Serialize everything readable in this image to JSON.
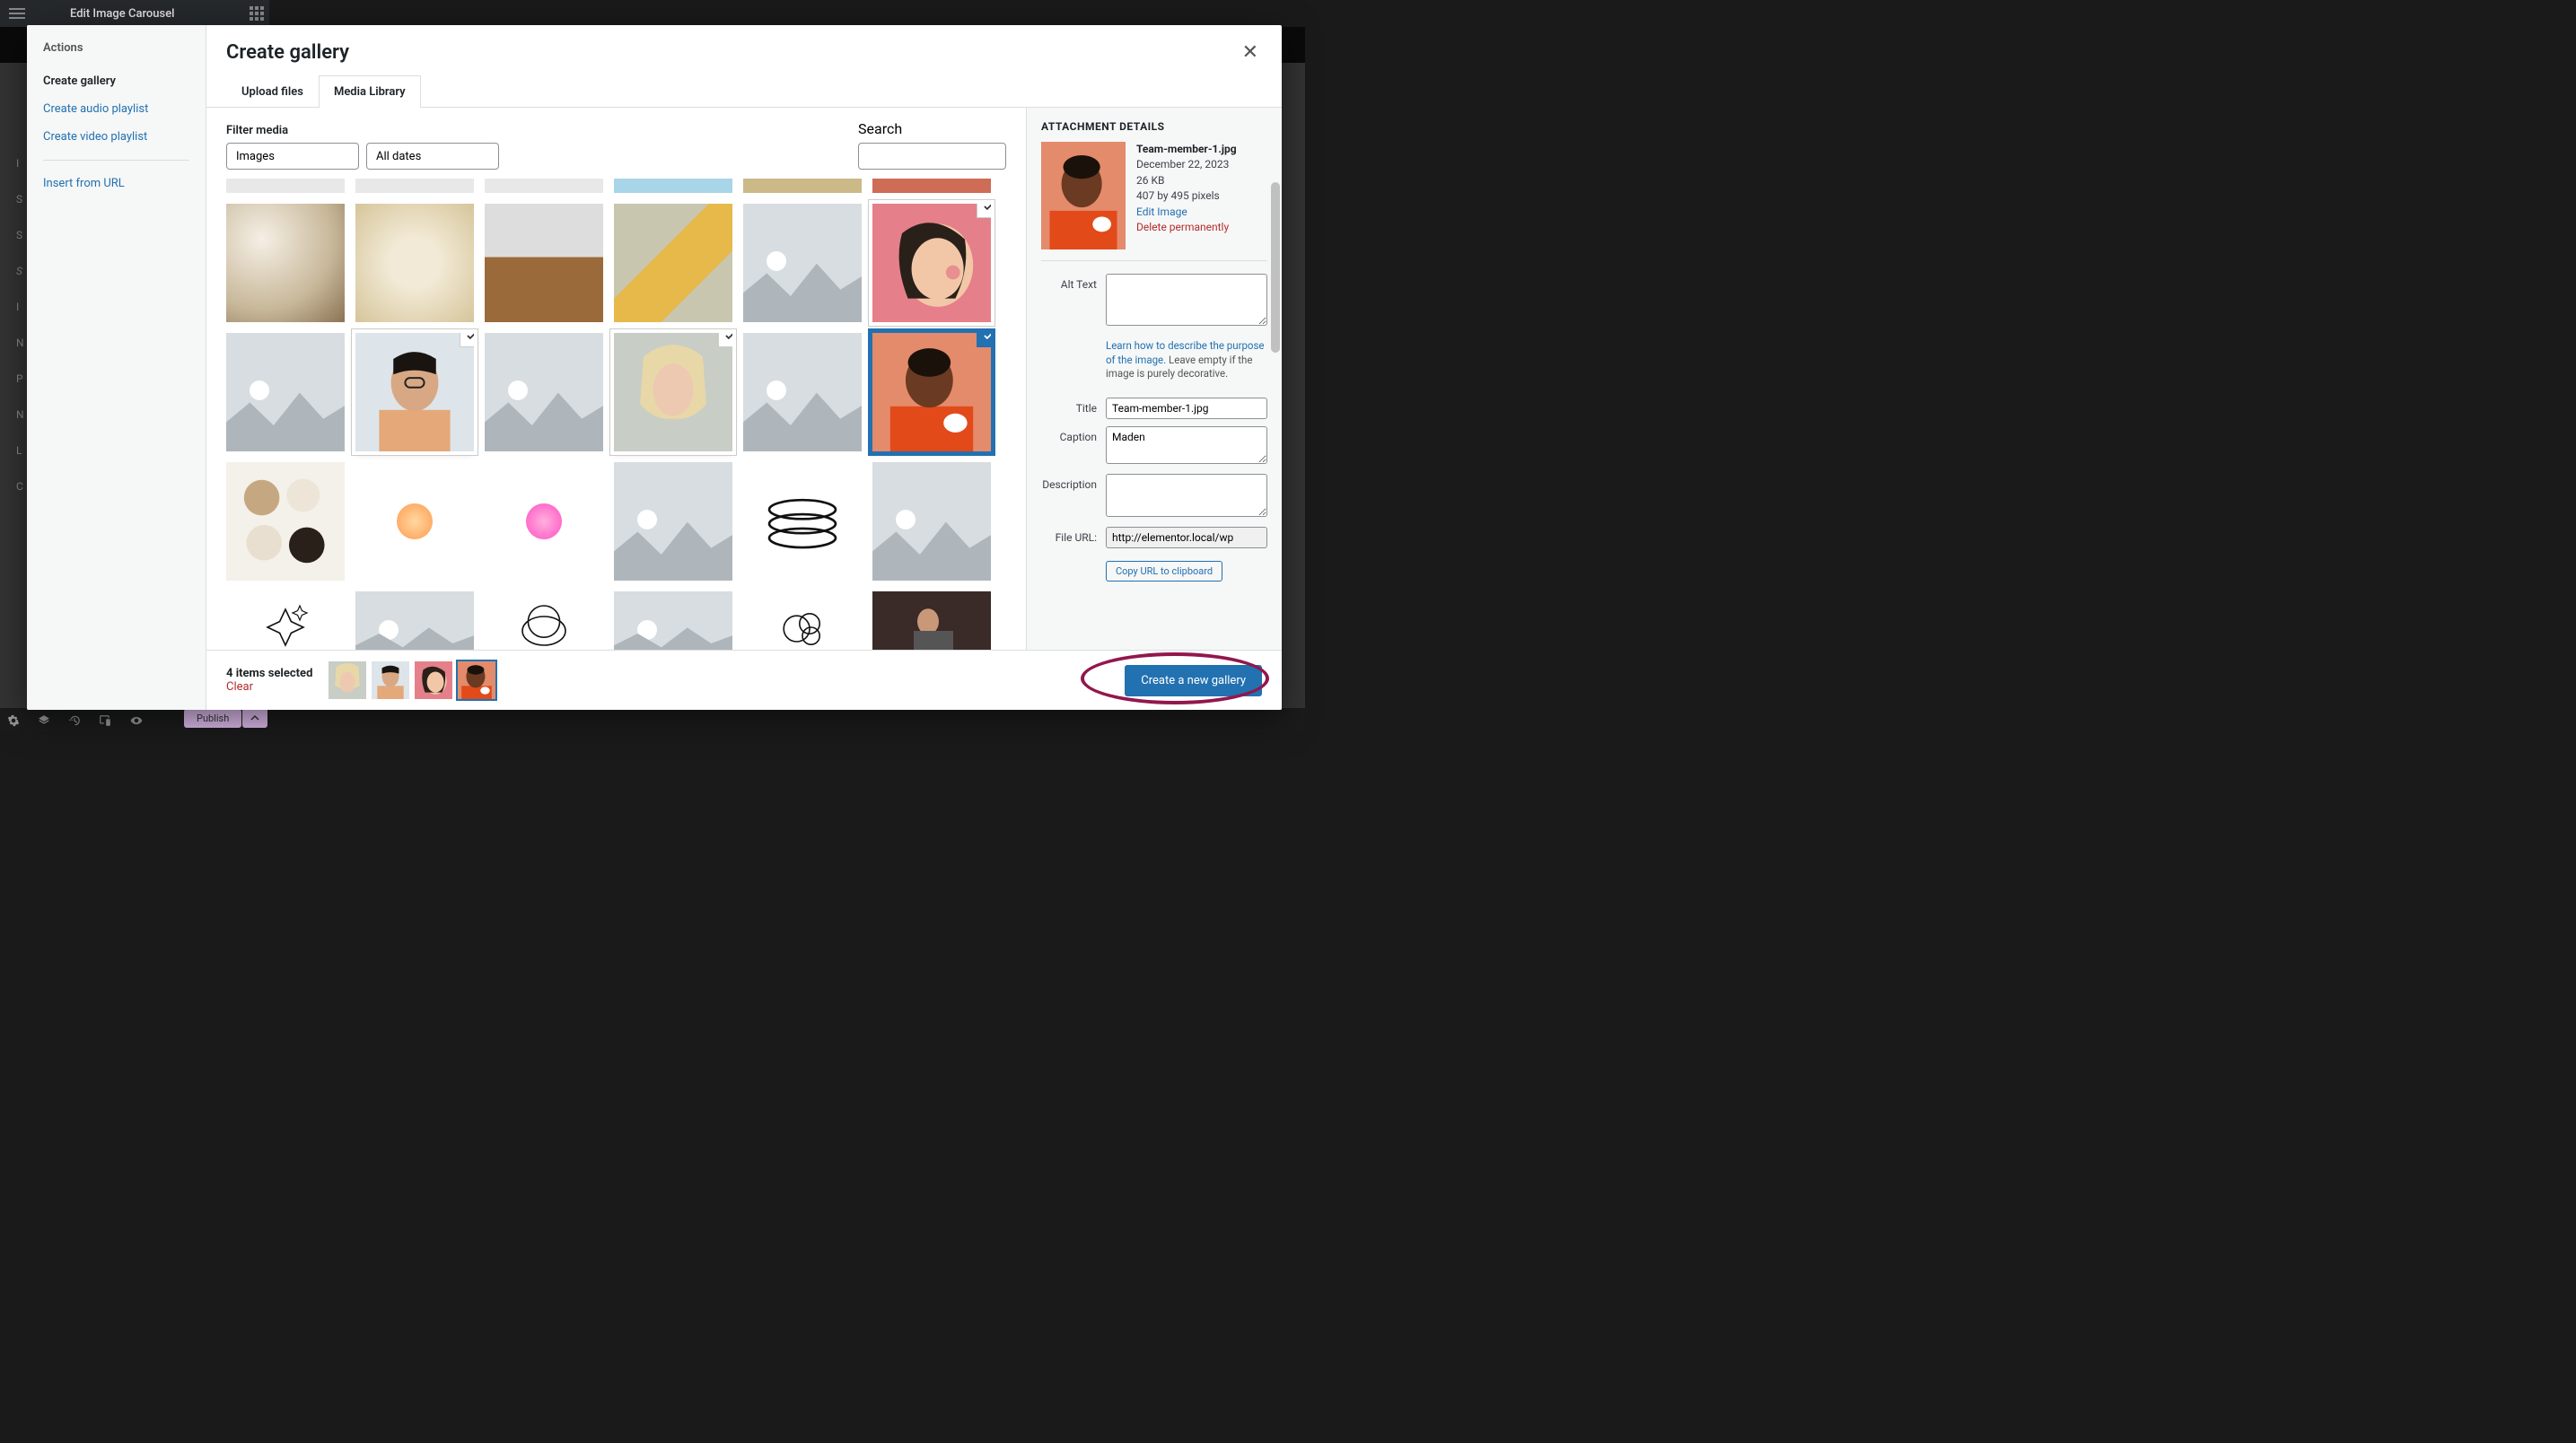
{
  "bgTitle": "Edit Image Carousel",
  "publish": "Publish",
  "sidebar": {
    "heading": "Actions",
    "items": [
      {
        "label": "Create gallery",
        "active": true
      },
      {
        "label": "Create audio playlist"
      },
      {
        "label": "Create video playlist"
      }
    ],
    "insertUrl": "Insert from URL"
  },
  "modal": {
    "title": "Create gallery",
    "tabs": {
      "upload": "Upload files",
      "library": "Media Library"
    },
    "filterLabel": "Filter media",
    "filterType": "Images",
    "filterDate": "All dates",
    "searchLabel": "Search"
  },
  "details": {
    "heading": "ATTACHMENT DETAILS",
    "filename": "Team-member-1.jpg",
    "date": "December 22, 2023",
    "size": "26 KB",
    "dims": "407 by 495 pixels",
    "editLink": "Edit Image",
    "deleteLink": "Delete permanently",
    "altLabel": "Alt Text",
    "altHelpLink": "Learn how to describe the purpose of the image.",
    "altHelpRest": " Leave empty if the image is purely decorative.",
    "titleLabel": "Title",
    "titleValue": "Team-member-1.jpg",
    "captionLabel": "Caption",
    "captionValue": "Maden",
    "descLabel": "Description",
    "urlLabel": "File URL:",
    "urlValue": "http://elementor.local/wp",
    "copyBtn": "Copy URL to clipboard"
  },
  "footer": {
    "count": "4 items selected",
    "clear": "Clear",
    "primary": "Create a new gallery"
  },
  "leftLabels": [
    "",
    "",
    "I",
    "S",
    "S",
    "S",
    "I",
    "N",
    "P",
    "N",
    "L",
    "C"
  ]
}
